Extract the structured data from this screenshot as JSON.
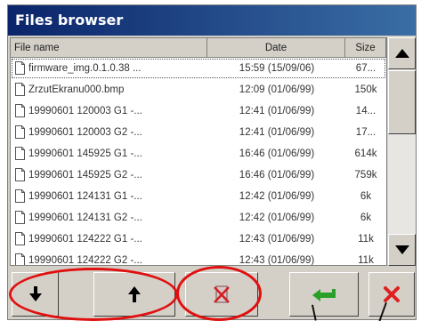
{
  "window": {
    "title": "Files browser"
  },
  "columns": {
    "name": "File name",
    "date": "Date",
    "size": "Size"
  },
  "files": [
    {
      "name": "firmware_img.0.1.0.38 ...",
      "date": "15:59 (15/09/06)",
      "size": "67..."
    },
    {
      "name": "ZrzutEkranu000.bmp",
      "date": "12:09 (01/06/99)",
      "size": "150k"
    },
    {
      "name": "19990601 120003 G1 -...",
      "date": "12:41 (01/06/99)",
      "size": "14..."
    },
    {
      "name": "19990601 120003 G2 -...",
      "date": "12:41 (01/06/99)",
      "size": "17..."
    },
    {
      "name": "19990601 145925 G1 -...",
      "date": "16:46 (01/06/99)",
      "size": "614k"
    },
    {
      "name": "19990601 145925 G2 -...",
      "date": "16:46 (01/06/99)",
      "size": "759k"
    },
    {
      "name": "19990601 124131 G1 -...",
      "date": "12:42 (01/06/99)",
      "size": "6k"
    },
    {
      "name": "19990601 124131 G2 -...",
      "date": "12:42 (01/06/99)",
      "size": "6k"
    },
    {
      "name": "19990601 124222 G1 -...",
      "date": "12:43 (01/06/99)",
      "size": "11k"
    },
    {
      "name": "19990601 124222 G2 -...",
      "date": "12:43 (01/06/99)",
      "size": "11k"
    }
  ],
  "selected_row": 0,
  "toolbar": {
    "buttons": [
      {
        "name": "move-down-button",
        "icon": "arrow-down-icon"
      },
      {
        "name": "move-up-button",
        "icon": "arrow-up-icon"
      },
      {
        "name": "delete-button",
        "icon": "delete-file-icon"
      },
      {
        "name": "enter-button",
        "icon": "enter-arrow-icon"
      },
      {
        "name": "cancel-button",
        "icon": "red-x-icon"
      }
    ]
  },
  "colors": {
    "title_bar": "#0a246a",
    "annotation": "#e01010",
    "enter_icon": "#2aa02a",
    "cancel_icon": "#e02020"
  }
}
